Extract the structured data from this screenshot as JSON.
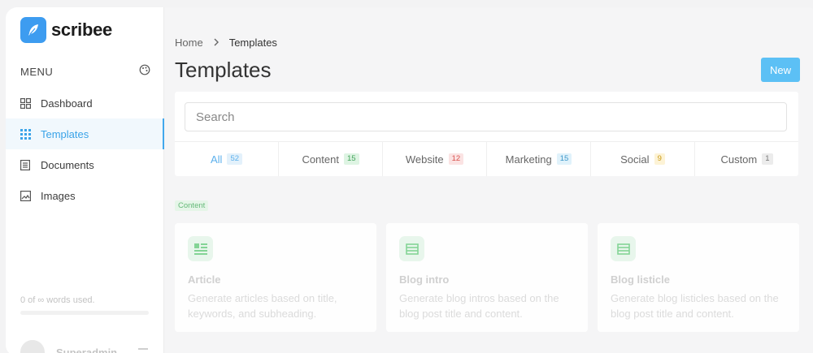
{
  "app": {
    "name": "scribee"
  },
  "sidebar": {
    "menu_label": "MENU",
    "items": [
      {
        "label": "Dashboard",
        "icon": "grid-icon"
      },
      {
        "label": "Templates",
        "icon": "dots-grid-icon",
        "active": true
      },
      {
        "label": "Documents",
        "icon": "document-icon"
      },
      {
        "label": "Images",
        "icon": "image-icon"
      }
    ],
    "usage_text": "0 of ∞ words used.",
    "user_name": "Superadmin"
  },
  "breadcrumb": {
    "home": "Home",
    "current": "Templates"
  },
  "header": {
    "title": "Templates",
    "new_label": "New"
  },
  "search": {
    "placeholder": "Search",
    "value": ""
  },
  "tabs": [
    {
      "label": "All",
      "count": "52",
      "active": true,
      "badge_bg": "#e3f1fb",
      "badge_color": "#5cb0ec"
    },
    {
      "label": "Content",
      "count": "15",
      "badge_bg": "#def4e3",
      "badge_color": "#43a35a"
    },
    {
      "label": "Website",
      "count": "12",
      "badge_bg": "#fbe3e3",
      "badge_color": "#d9534f"
    },
    {
      "label": "Marketing",
      "count": "15",
      "badge_bg": "#e0f2fb",
      "badge_color": "#3b96c9"
    },
    {
      "label": "Social",
      "count": "9",
      "badge_bg": "#fdf3d6",
      "badge_color": "#c99a16"
    },
    {
      "label": "Custom",
      "count": "1",
      "badge_bg": "#ececec",
      "badge_color": "#777777"
    }
  ],
  "section": {
    "tag": "Content"
  },
  "cards": [
    {
      "title": "Article",
      "description": "Generate articles based on title, keywords, and subheading.",
      "icon": "article-icon"
    },
    {
      "title": "Blog intro",
      "description": "Generate blog intros based on the blog post title and content.",
      "icon": "blog-icon"
    },
    {
      "title": "Blog listicle",
      "description": "Generate blog listicles based on the blog post title and content.",
      "icon": "list-icon"
    }
  ],
  "colors": {
    "accent": "#5cc0f5",
    "active_text": "#3aa3e8",
    "logo": "#3d9cf0"
  }
}
